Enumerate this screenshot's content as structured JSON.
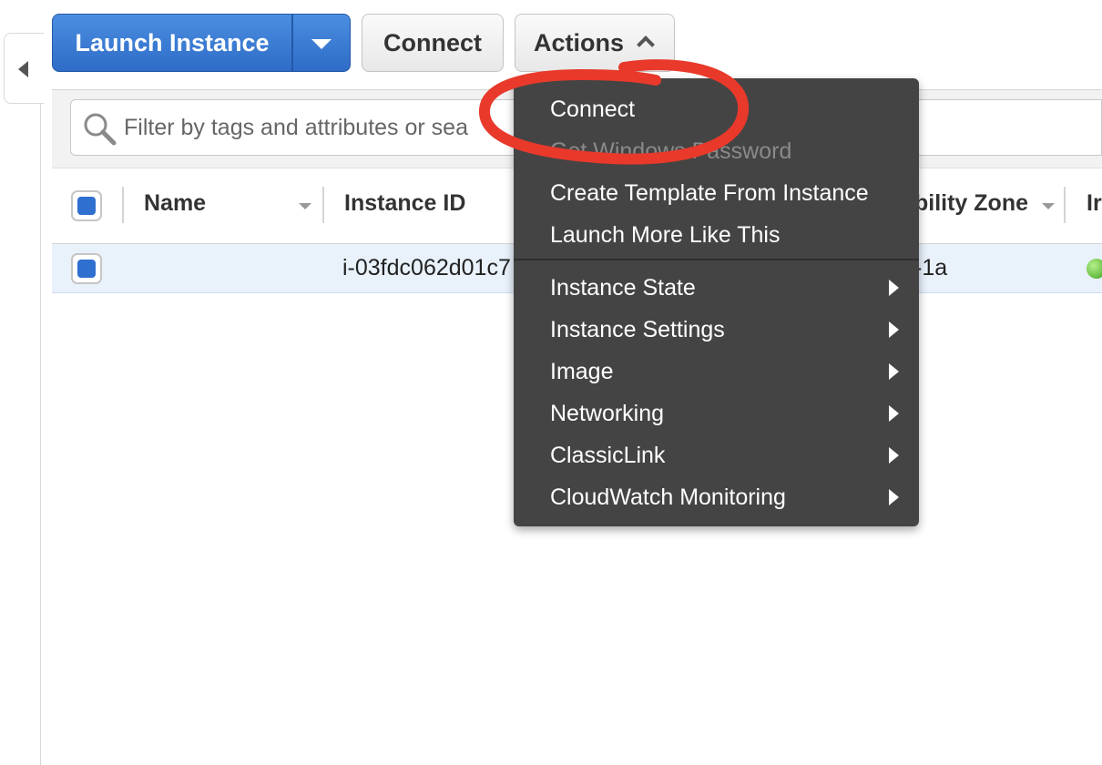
{
  "toolbar": {
    "launch_label": "Launch Instance",
    "connect_label": "Connect",
    "actions_label": "Actions"
  },
  "search": {
    "placeholder_visible": "Filter by tags and attributes or sea"
  },
  "table": {
    "columns": [
      "Name",
      "Instance ID",
      "bility Zone",
      "Ir"
    ],
    "rows": [
      {
        "name": "",
        "instance_id": "i-03fdc062d01c7",
        "zone": "-1a"
      }
    ]
  },
  "actions_menu": {
    "items": [
      {
        "label": "Connect",
        "enabled": true
      },
      {
        "label": "Get Windows Password",
        "enabled": false
      },
      {
        "label": "Create Template From Instance",
        "enabled": true
      },
      {
        "label": "Launch More Like This",
        "enabled": true
      }
    ],
    "submenus": [
      {
        "label": "Instance State"
      },
      {
        "label": "Instance Settings"
      },
      {
        "label": "Image"
      },
      {
        "label": "Networking"
      },
      {
        "label": "ClassicLink"
      },
      {
        "label": "CloudWatch Monitoring"
      }
    ]
  },
  "colors": {
    "primary_button": "#2e6cc7",
    "menu_bg": "#444444",
    "selected_row": "#e9f1fb",
    "annotation": "#e8392b",
    "status_running": "#3aa11c"
  }
}
